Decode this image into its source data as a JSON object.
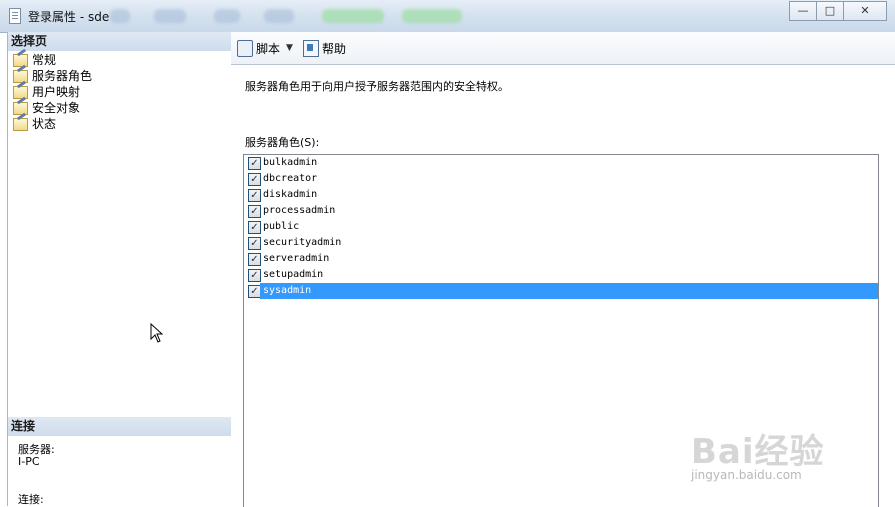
{
  "window": {
    "title": "登录属性 - sde",
    "controls": {
      "minimize": "—",
      "maximize": "□",
      "close": "✕"
    }
  },
  "left_pane": {
    "select_page_header": "选择页",
    "nav_items": [
      {
        "label": "常规"
      },
      {
        "label": "服务器角色"
      },
      {
        "label": "用户映射"
      },
      {
        "label": "安全对象"
      },
      {
        "label": "状态"
      }
    ],
    "connection": {
      "header": "连接",
      "server_label": "服务器:",
      "server_value": "I-PC",
      "connection_label": "连接:"
    }
  },
  "toolbar": {
    "script_label": "脚本",
    "help_label": "帮助"
  },
  "main": {
    "description": "服务器角色用于向用户授予服务器范围内的安全特权。",
    "roles_label": "服务器角色(S):",
    "roles": [
      {
        "name": "bulkadmin",
        "checked": true
      },
      {
        "name": "dbcreator",
        "checked": true
      },
      {
        "name": "diskadmin",
        "checked": true
      },
      {
        "name": "processadmin",
        "checked": true
      },
      {
        "name": "public",
        "checked": true
      },
      {
        "name": "securityadmin",
        "checked": true
      },
      {
        "name": "serveradmin",
        "checked": true
      },
      {
        "name": "setupadmin",
        "checked": true
      },
      {
        "name": "sysadmin",
        "checked": true,
        "selected": true
      }
    ]
  },
  "watermark": {
    "text": "Bai经验",
    "url_text": "jingyan.baidu.com"
  },
  "colors": {
    "selection": "#3399ff",
    "titlebar": "#d4e1ef",
    "section_header": "#cfdcec"
  }
}
